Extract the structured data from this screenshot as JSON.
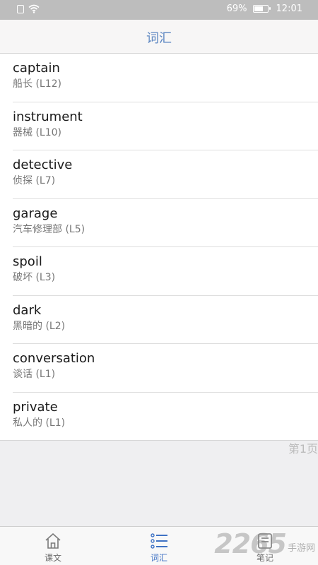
{
  "status_bar": {
    "battery": "69%",
    "battery_level": 0.69,
    "time": "12:01",
    "icons": [
      "sim-icon",
      "wifi-icon",
      "battery-icon"
    ]
  },
  "header": {
    "title": "词汇"
  },
  "vocab": [
    {
      "word": "captain",
      "meaning": "船长 (L12)"
    },
    {
      "word": "instrument",
      "meaning": "器械 (L10)"
    },
    {
      "word": "detective",
      "meaning": "侦探 (L7)"
    },
    {
      "word": "garage",
      "meaning": "汽车修理部 (L5)"
    },
    {
      "word": "spoil",
      "meaning": "破坏 (L3)"
    },
    {
      "word": "dark",
      "meaning": "黑暗的 (L2)"
    },
    {
      "word": "conversation",
      "meaning": "谈话 (L1)"
    },
    {
      "word": "private",
      "meaning": "私人的 (L1)"
    }
  ],
  "page_indicator": "第1页",
  "tabs": [
    {
      "label": "课文",
      "icon": "home-icon",
      "active": false
    },
    {
      "label": "词汇",
      "icon": "list-icon",
      "active": true
    },
    {
      "label": "笔记",
      "icon": "note-icon",
      "active": false
    }
  ],
  "watermark": {
    "big": "2265",
    "small": "手游网"
  },
  "colors": {
    "accent": "#3f72c4",
    "header_title": "#5d87c2",
    "status_bar": "#bdbdbd",
    "background": "#efeff1"
  }
}
